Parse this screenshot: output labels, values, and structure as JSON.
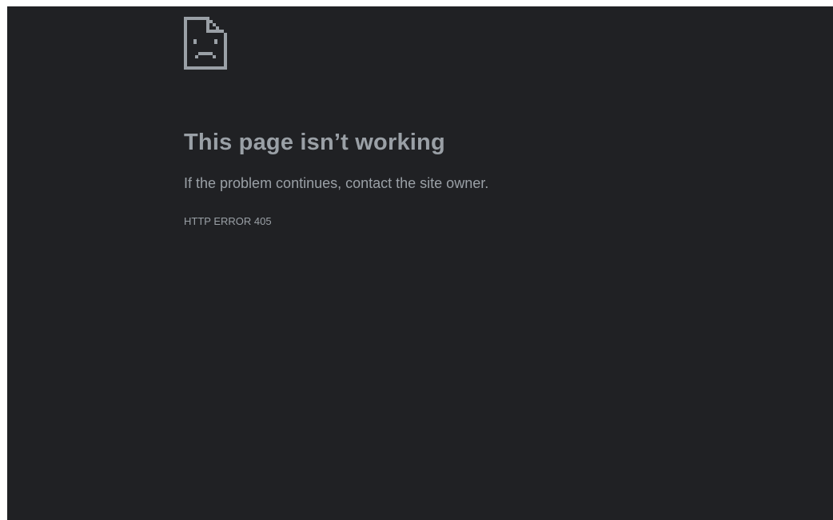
{
  "error_page": {
    "icon": "sad-page-icon",
    "headline": "This page isn’t working",
    "message": "If the problem continues, contact the site owner.",
    "error_code": "HTTP ERROR 405"
  },
  "colors": {
    "background": "#202124",
    "text": "#9aa0a6",
    "icon": "#9aa0a6"
  }
}
